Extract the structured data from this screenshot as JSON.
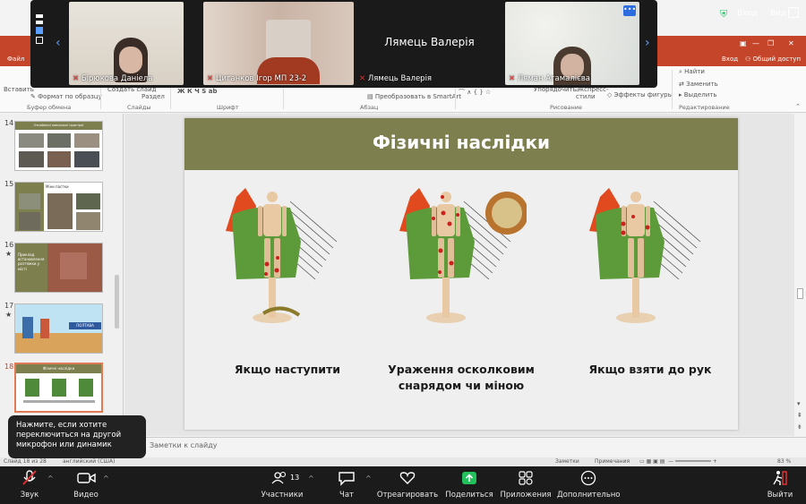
{
  "participants": [
    {
      "name": "Бірюкова Даніела",
      "muted": true
    },
    {
      "name": "Циганков Ігор МП 23-2",
      "muted": true
    },
    {
      "name": "Лямець Валерія",
      "muted": true,
      "display_name": "Лямець Валерія"
    },
    {
      "name": "Ляман Агамалієва",
      "muted": true
    }
  ],
  "topbar": {
    "enter": "Вход",
    "view": "Вид"
  },
  "ppt": {
    "tabs": [
      "Файл",
      "Вход",
      "Общий доступ"
    ],
    "ribbon": {
      "paste": "Вставить",
      "create_slide": "Создать слайд",
      "section": "Раздел",
      "format_painter": "Формат по образцу",
      "convert_smartart": "Преобразовать в SmartArt",
      "arrange": "Упорядочить",
      "quick_styles": "Экспресс-стили",
      "shape_effects": "Эффекты фигуры",
      "find": "Найти",
      "replace": "Заменить",
      "select": "Выделить",
      "groups": [
        "Буфер обмена",
        "Слайды",
        "Шрифт",
        "Абзац",
        "Рисование",
        "Редактирование"
      ]
    },
    "thumbnails": [
      {
        "num": "14",
        "title": "Ознайомчі навчальні пристрої",
        "star": false
      },
      {
        "num": "15",
        "title": "Міни пастки",
        "star": false
      },
      {
        "num": "16",
        "title": "Приклад встановлення розтяжки у місті",
        "star": true
      },
      {
        "num": "17",
        "title": "",
        "star": true,
        "sign": "ПОЛТАВА"
      },
      {
        "num": "18",
        "title": "Фізичні наслідки",
        "star": false,
        "selected": true
      }
    ],
    "slide": {
      "title": "Фізичні наслідки",
      "captions": [
        "Якщо наступити",
        "Ураження осколковим снарядом чи міною",
        "Якщо взяти до рук"
      ]
    },
    "notes_placeholder": "Заметки к слайду",
    "status": {
      "slide": "Слайд 18 из 28",
      "lang": "английский (США)",
      "notes": "Заметки",
      "comments": "Примечания",
      "zoom": "83 %"
    }
  },
  "tooltip": "Нажмите, если хотите переключиться на другой микрофон или динамик",
  "toolbar": {
    "audio": "Звук",
    "video": "Видео",
    "participants": "Участники",
    "participants_count": "13",
    "chat": "Чат",
    "react": "Отреагировать",
    "share": "Поделиться",
    "apps": "Приложения",
    "more": "Дополнительно",
    "leave": "Выйти"
  }
}
